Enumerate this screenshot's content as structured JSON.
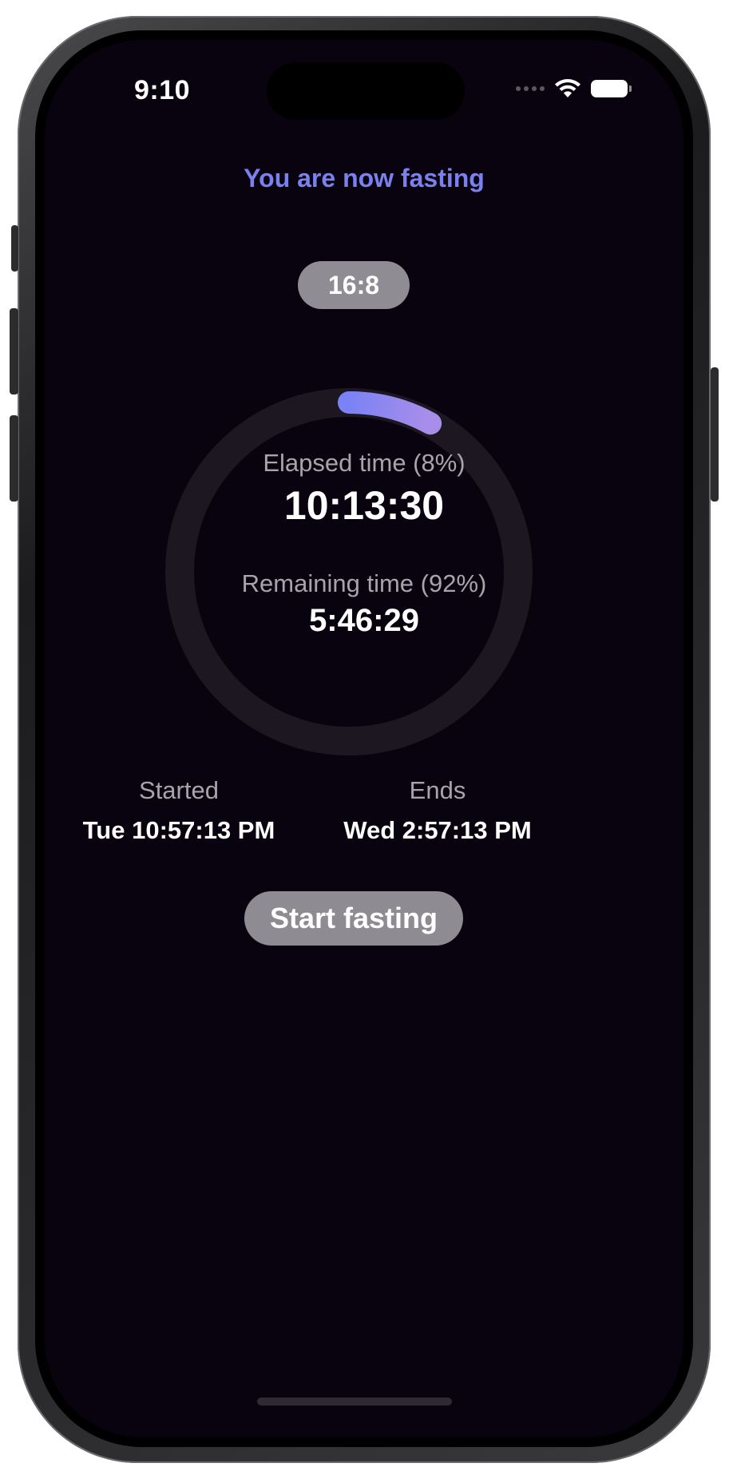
{
  "status_bar": {
    "time": "9:10",
    "icons": [
      "cellular-signal-icon",
      "wifi-icon",
      "battery-icon"
    ]
  },
  "header": {
    "title": "You are now fasting"
  },
  "plan": {
    "label": "16:8"
  },
  "progress_ring": {
    "progress_fraction": 0.08,
    "track_color": "#1d1721",
    "gradient_start": "#7b82f5",
    "gradient_end": "#a98ee9"
  },
  "elapsed": {
    "label": "Elapsed time (8%)",
    "value": "10:13:30"
  },
  "remaining": {
    "label": "Remaining time (92%)",
    "value": "5:46:29"
  },
  "started": {
    "label": "Started",
    "value": "Tue 10:57:13 PM"
  },
  "ends": {
    "label": "Ends",
    "value": "Wed 2:57:13 PM"
  },
  "actions": {
    "start_label": "Start fasting"
  },
  "colors": {
    "background": "#09030f",
    "accent": "#7b80f0",
    "pill": "#908c94"
  }
}
